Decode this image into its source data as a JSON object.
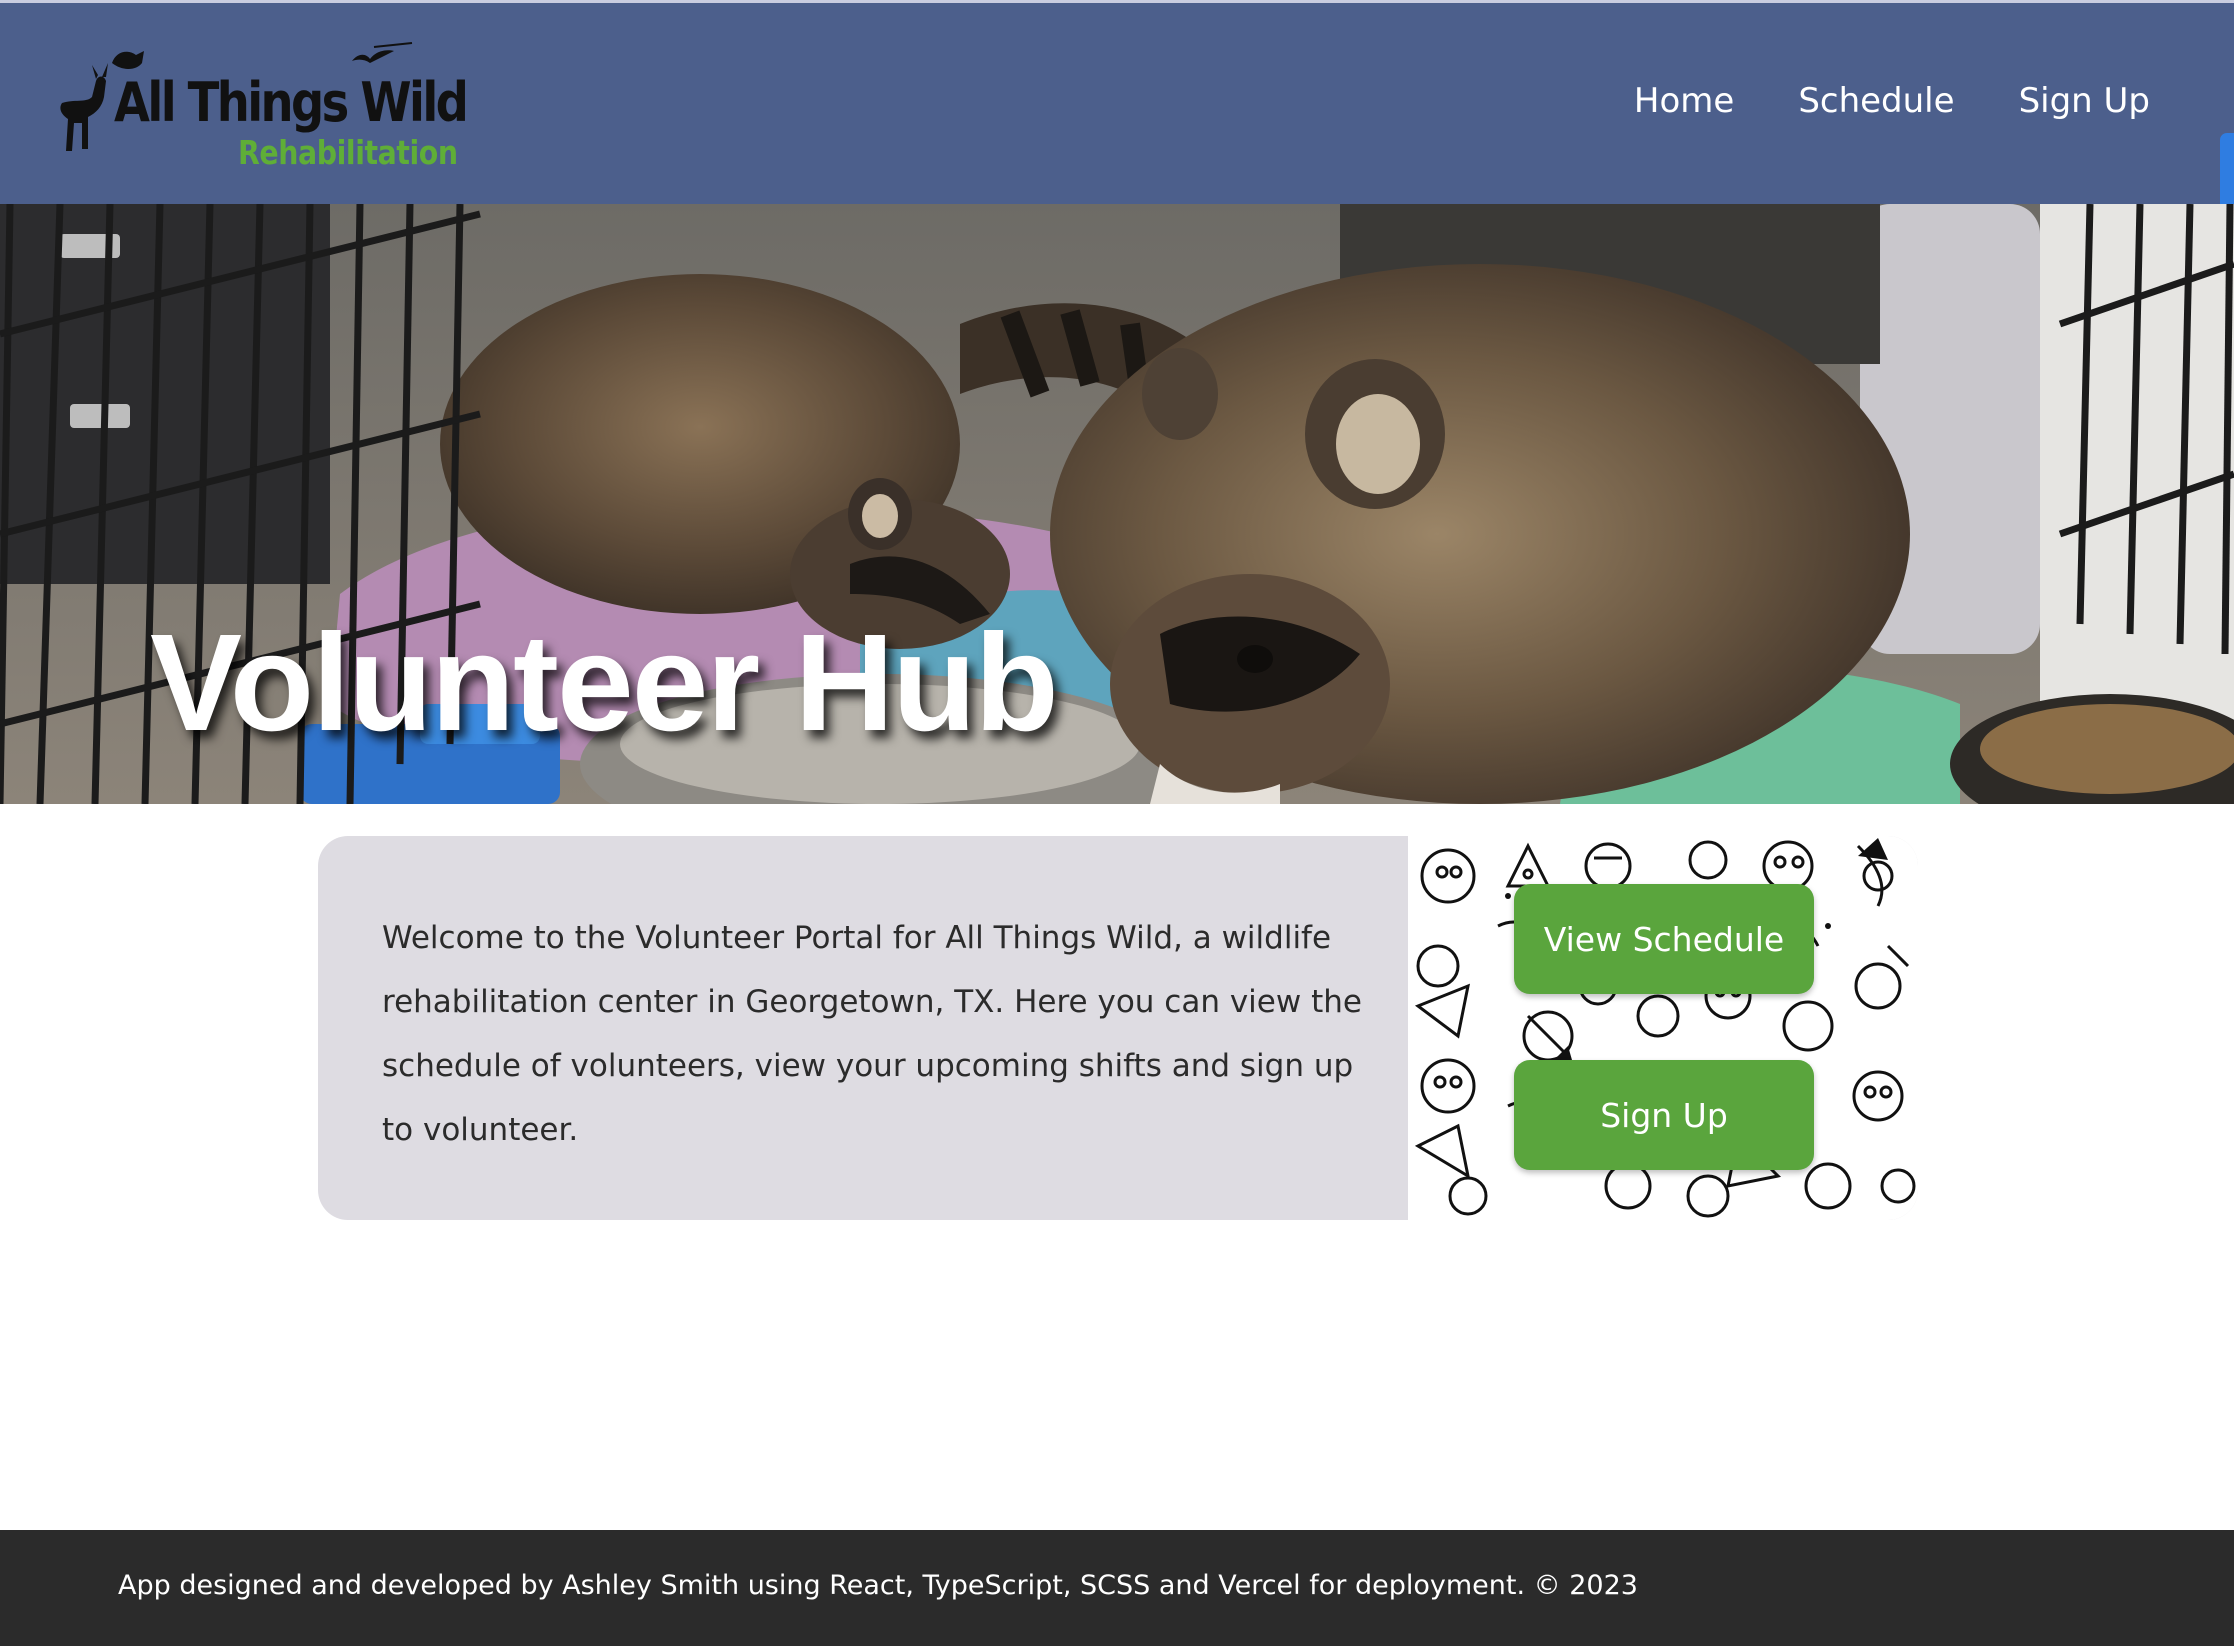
{
  "header": {
    "logo": {
      "title": "All Things Wild",
      "subtitle": "Rehabilitation"
    },
    "nav": [
      {
        "label": "Home"
      },
      {
        "label": "Schedule"
      },
      {
        "label": "Sign Up"
      }
    ]
  },
  "hero": {
    "title": "Volunteer Hub",
    "image": "raccoons-in-cage-photo"
  },
  "intro": {
    "text": "Welcome to the Volunteer Portal for All Things Wild, a wildlife rehabilitation center in Georgetown, TX. Here you can view the schedule of volunteers, view your upcoming shifts and sign up to volunteer.",
    "buttons": {
      "view_schedule": "View Schedule",
      "sign_up": "Sign Up"
    }
  },
  "footer": {
    "text": "App designed and developed by Ashley Smith using React, TypeScript, SCSS and Vercel for deployment. © 2023"
  },
  "colors": {
    "header_bg": "#4c5f8c",
    "accent_green": "#5aa53d",
    "card_bg": "#dedce2",
    "footer_bg": "#2b2b2b"
  }
}
